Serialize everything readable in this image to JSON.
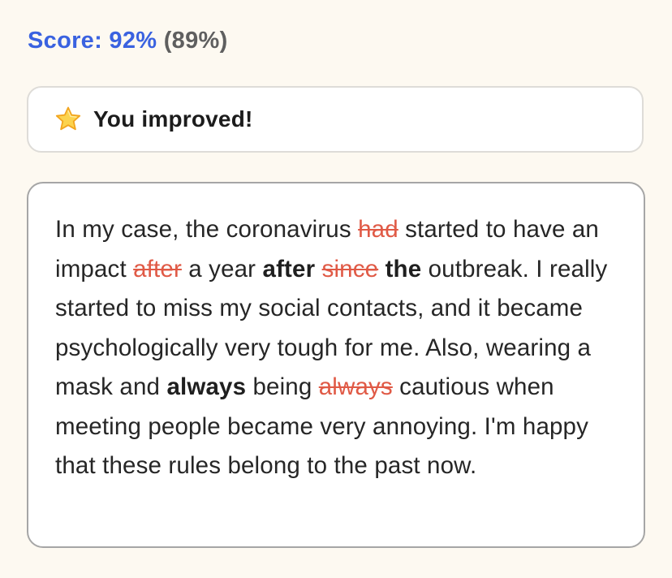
{
  "score": {
    "label": "Score: 92%",
    "previous": "(89%)"
  },
  "banner": {
    "icon": "star-icon",
    "text": "You improved!"
  },
  "passage": {
    "segments": [
      {
        "type": "text",
        "text": "In my case, the coronavirus "
      },
      {
        "type": "deleted",
        "text": "had"
      },
      {
        "type": "text",
        "text": " started to have an impact "
      },
      {
        "type": "deleted",
        "text": "after"
      },
      {
        "type": "text",
        "text": " a year "
      },
      {
        "type": "inserted",
        "text": "after"
      },
      {
        "type": "text",
        "text": " "
      },
      {
        "type": "deleted",
        "text": "since"
      },
      {
        "type": "text",
        "text": " "
      },
      {
        "type": "inserted",
        "text": "the"
      },
      {
        "type": "text",
        "text": " outbreak. I really started to miss my social contacts, and it became psychologically very tough for me. Also, wearing a mask and "
      },
      {
        "type": "inserted",
        "text": "always"
      },
      {
        "type": "text",
        "text": " being "
      },
      {
        "type": "deleted",
        "text": "always"
      },
      {
        "type": "text",
        "text": " cautious when meeting people became very annoying. I'm happy that these rules belong to the past now."
      }
    ]
  },
  "colors": {
    "score": "#3a62e0",
    "previous_score": "#5f5f5f",
    "deleted": "#e05a46",
    "background": "#fdf9f1"
  }
}
